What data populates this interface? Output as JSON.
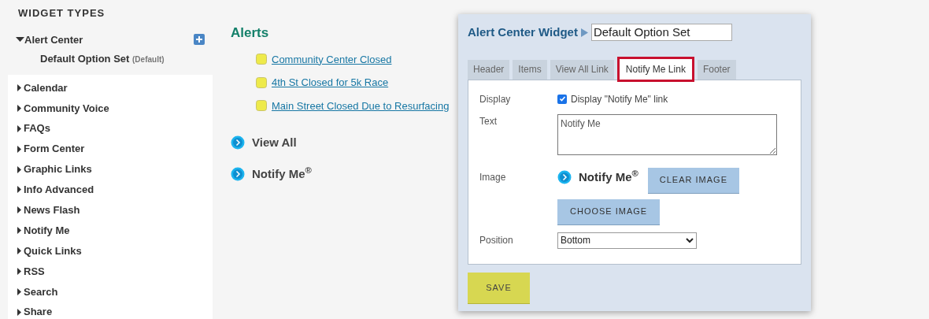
{
  "sidebar": {
    "title": "WIDGET TYPES",
    "expanded_item": {
      "label": "Alert Center",
      "expanded": true,
      "children": [
        {
          "label": "Default Option Set",
          "badge": "(Default)"
        }
      ]
    },
    "items": [
      {
        "label": "Calendar",
        "expanded": false
      },
      {
        "label": "Community Voice",
        "expanded": false
      },
      {
        "label": "FAQs",
        "expanded": false
      },
      {
        "label": "Form Center",
        "expanded": false
      },
      {
        "label": "Graphic Links",
        "expanded": false
      },
      {
        "label": "Info Advanced",
        "expanded": false
      },
      {
        "label": "News Flash",
        "expanded": false
      },
      {
        "label": "Notify Me",
        "expanded": false
      },
      {
        "label": "Quick Links",
        "expanded": false
      },
      {
        "label": "RSS",
        "expanded": false
      },
      {
        "label": "Search",
        "expanded": false
      },
      {
        "label": "Share",
        "expanded": false
      }
    ]
  },
  "preview": {
    "title": "Alerts",
    "alerts": [
      "Community Center Closed",
      "4th St Closed for 5k Race",
      "Main Street Closed Due to Resurfacing"
    ],
    "links": [
      "View All",
      "Notify Me$^{®}$"
    ]
  },
  "dialog": {
    "title": "Alert Center Widget",
    "name_value": "Default Option Set",
    "tabs": [
      {
        "label": "Header",
        "selected": false
      },
      {
        "label": "Items",
        "selected": false
      },
      {
        "label": "View All Link",
        "selected": false
      },
      {
        "label": "Notify Me Link",
        "selected": true
      },
      {
        "label": "Footer",
        "selected": false
      }
    ],
    "display_label": "Display",
    "display_checkbox": {
      "label": "Display \"Notify Me\" link",
      "checked": true
    },
    "text_label": "Text",
    "text_value": "Notify Me",
    "image_label": "Image",
    "image_preview": "Notify Me$^{®}$",
    "clear_button": "CLEAR IMAGE",
    "choose_button": "CHOOSE IMAGE",
    "position_label": "Position",
    "position_value": "Bottom",
    "save_button": "SAVE"
  }
}
